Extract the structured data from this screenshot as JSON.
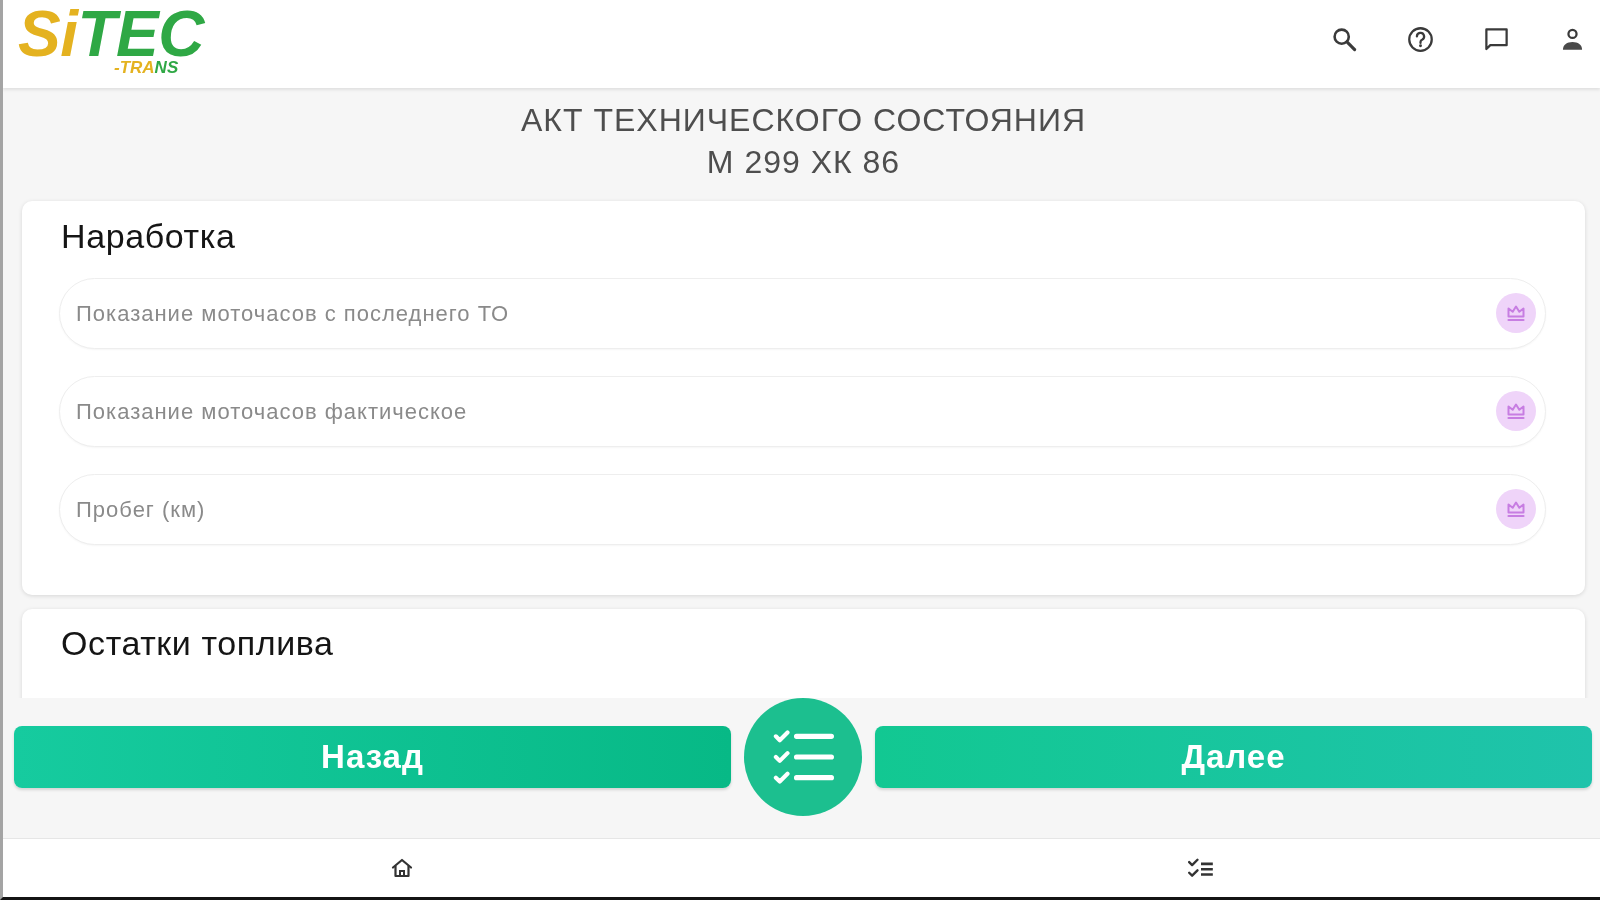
{
  "header": {
    "logo": {
      "wordmark": [
        {
          "text": "Si",
          "color": "#e4b220"
        },
        {
          "text": "TEC",
          "color": "#2fa845"
        }
      ],
      "tagline": [
        {
          "text": "-TRA",
          "color": "#e4b220"
        },
        {
          "text": "NS",
          "color": "#2fa845"
        }
      ]
    }
  },
  "title": "АКТ ТЕХНИЧЕСКОГО СОСТОЯНИЯ",
  "vehicle_number": "М 299 ХК 86",
  "sections": [
    {
      "heading": "Наработка",
      "fields": [
        {
          "placeholder": "Показание моточасов с последнего ТО"
        },
        {
          "placeholder": "Показание моточасов фактическое"
        },
        {
          "placeholder": "Пробег (км)"
        }
      ]
    },
    {
      "heading": "Остатки топлива"
    }
  ],
  "bottom_actions": {
    "back": "Назад",
    "next": "Далее"
  }
}
